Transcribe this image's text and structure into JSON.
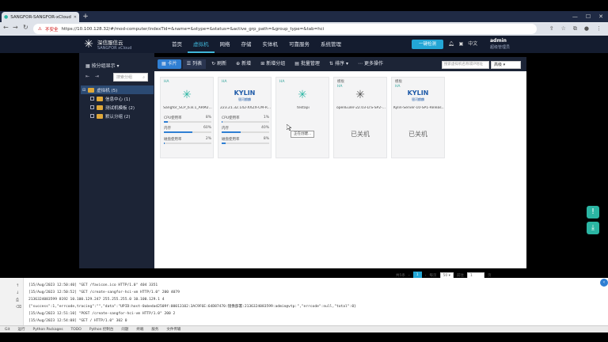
{
  "browser": {
    "tab_title": "SANGFOR-SANGFOR-xCloud",
    "new_tab": "+",
    "win_controls": [
      "—",
      "☐",
      "✕"
    ],
    "nav": [
      "←",
      "→",
      "↻"
    ],
    "security_warning": "不安全",
    "url": "https://10.100.128.32/#/mod-computer/indexTid=&name=&stype=&status=&active_grp_path=&group_type=&tab=hci"
  },
  "header": {
    "logo_title": "深信服信云",
    "logo_sub": "SANGFOR xCloud",
    "nav_items": [
      "首页",
      "虚拟机",
      "网络",
      "存储",
      "实体机",
      "可靠服务",
      "系统管理"
    ],
    "active_nav": 1,
    "one_key_label": "一键检测",
    "lang": "中文",
    "username": "admin",
    "role": "超级管理员"
  },
  "sidebar": {
    "group_selector": "按分组显示",
    "search_placeholder": "搜索分组",
    "tree": [
      {
        "label": "虚拟机 (5)",
        "level": 0,
        "selected": true
      },
      {
        "label": "信息中心 (1)",
        "level": 1,
        "selected": false
      },
      {
        "label": "测试机模板 (2)",
        "level": 1,
        "selected": false
      },
      {
        "label": "默认分组 (2)",
        "level": 1,
        "selected": false
      }
    ]
  },
  "toolbar": {
    "view_card": "卡片",
    "view_list": "列表",
    "refresh": "刷新",
    "new": "新增",
    "new_group": "新增分组",
    "batch": "批量管理",
    "sort": "排序",
    "more": "更多操作",
    "search_placeholder": "搜索虚拟机名称或IP地址",
    "advanced": "高级"
  },
  "cards": [
    {
      "badge": "HA",
      "name": "Sangfor_SCP_6.8.1_ARM2...",
      "icon": "sangfor-icon",
      "cpu_label": "CPU使用率",
      "cpu": "8%",
      "mem_label": "内存",
      "mem": "60%",
      "disk_label": "磁盘使用率",
      "disk": "2%",
      "cpu_pct": 8,
      "mem_pct": 60,
      "disk_pct": 2
    },
    {
      "badge": "HA",
      "name": "223.21.32.142-XXZX-CM-R...",
      "icon": "kylin-icon",
      "cpu_label": "CPU使用率",
      "cpu": "1%",
      "mem_label": "内存",
      "mem": "40%",
      "disk_label": "磁盘使用率",
      "disk": "8%",
      "cpu_pct": 1,
      "mem_pct": 40,
      "disk_pct": 8
    },
    {
      "badge": "HA",
      "name": "testapi",
      "icon": "sangfor-icon"
    },
    {
      "badge": "模板",
      "badge2": "HA",
      "name": "openEuler-22.03-LTS-SP2-...",
      "icon": "sangfor-icon",
      "status": "已关机"
    },
    {
      "badge": "模板",
      "badge2": "HA",
      "name": "Kylin-Server-10-SP1-Releas...",
      "icon": "kylin-icon",
      "status": "已关机"
    }
  ],
  "kylin_logo": {
    "main": "KYLIN",
    "sub": "银河麒麟"
  },
  "tooltip": "正在创建...",
  "pager": {
    "total_label": "共5条",
    "current": "1",
    "per_page_label": "每页",
    "per_page": "50",
    "goto_label": "前往",
    "goto_value": "1",
    "page_suffix": "页"
  },
  "console": {
    "logs": [
      "[15/Aug/2023 12:50:40] \"GET /favicon.ico HTTP/1.0\" 404 3351",
      "[15/Aug/2023 12:50:52] \"GET /create-sangfor-hci-vm HTTP/1.0\" 200 4079",
      "2136324083599 8192 10.100.129.247 255.255.255.0 10.100.129.1 4",
      "{\"success\":1,\"errcode,tracing\":\"\",\"data\":\"UPID:host-0abedad2509f:00013102:3AC9F6E:64D87470:镜像部署:2136324083599:admin@vtp:\",\"errcode\":null,\"total\":0}",
      "[15/Aug/2023 12:51:10] \"POST /create-sangfor-hci-vm HTTP/1.0\" 200 2",
      "[15/Aug/2023 12:54:08] \"GET / HTTP/1.0\" 302 0"
    ],
    "status_items": [
      "Git",
      "运行",
      "Python Packages",
      "TODO",
      "Python 控制台",
      "问题",
      "终端",
      "服务",
      "文件传输"
    ]
  }
}
